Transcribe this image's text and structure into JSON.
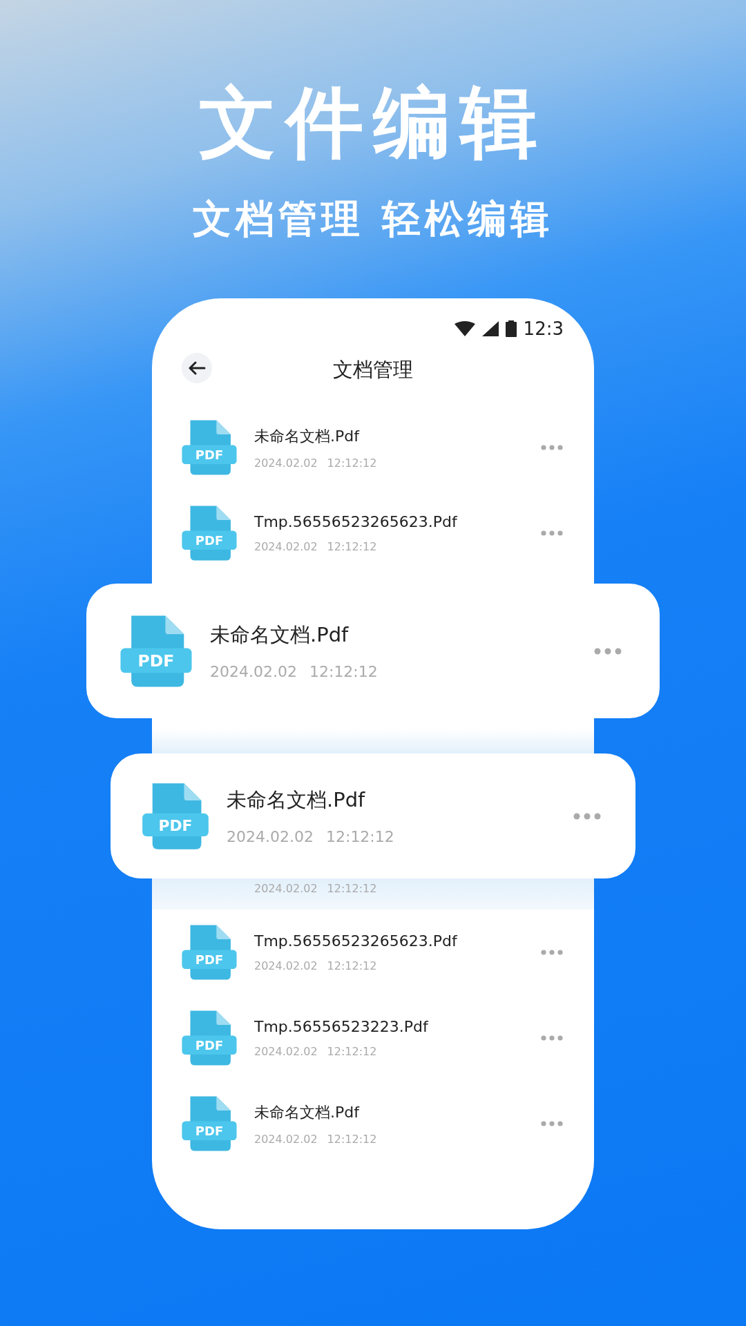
{
  "headline": "文件编辑",
  "tagline": "文档管理 轻松编辑",
  "status_bar": {
    "time": "12:3"
  },
  "header": {
    "title": "文档管理"
  },
  "files": [
    {
      "kind": "full",
      "name": "未命名文档.Pdf",
      "date": "2024.02.02",
      "time": "12:12:12",
      "icon_label": "PDF"
    },
    {
      "kind": "full",
      "name": "Tmp.56556523265623.Pdf",
      "date": "2024.02.02",
      "time": "12:12:12",
      "icon_label": "PDF"
    },
    {
      "kind": "date_only",
      "date": "2024.02.02",
      "time": "12:12:12"
    },
    {
      "kind": "full",
      "name": "Tmp.56556523265623.Pdf",
      "date": "2024.02.02",
      "time": "12:12:12",
      "icon_label": "PDF"
    },
    {
      "kind": "full",
      "name": "Tmp.56556523223.Pdf",
      "date": "2024.02.02",
      "time": "12:12:12",
      "icon_label": "PDF"
    },
    {
      "kind": "full",
      "name": "未命名文档.Pdf",
      "date": "2024.02.02",
      "time": "12:12:12",
      "icon_label": "PDF"
    }
  ],
  "featured": [
    {
      "name": "未命名文档.Pdf",
      "date": "2024.02.02",
      "time": "12:12:12",
      "icon_label": "PDF"
    },
    {
      "name": "未命名文档.Pdf",
      "date": "2024.02.02",
      "time": "12:12:12",
      "icon_label": "PDF"
    }
  ]
}
